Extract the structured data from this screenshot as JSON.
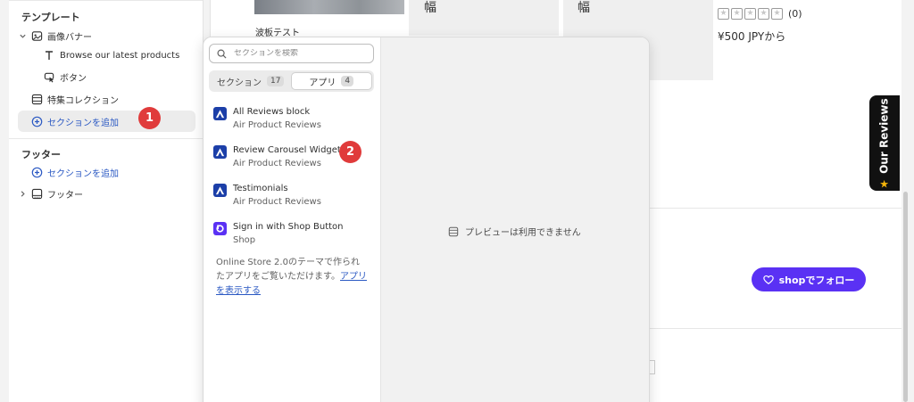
{
  "sidebar": {
    "template_heading": "テンプレート",
    "items": [
      {
        "label": "画像バナー"
      },
      {
        "label": "Browse our latest products"
      },
      {
        "label": "ボタン"
      },
      {
        "label": "特集コレクション"
      },
      {
        "label": "セクションを追加"
      }
    ],
    "footer_heading": "フッター",
    "footer_items": [
      {
        "label": "セクションを追加"
      },
      {
        "label": "フッター"
      }
    ]
  },
  "store": {
    "product_title": "波板テスト",
    "haba_1": "幅",
    "haba_2": "幅",
    "review_count": "(0)",
    "price": "¥500 JPYから",
    "follow_label": "でフォロー",
    "follow_brand": "shop",
    "reviews_tab": "Our Reviews"
  },
  "popover": {
    "search_placeholder": "セクションを検索",
    "tabs": [
      {
        "label": "セクション",
        "count": "17"
      },
      {
        "label": "アプリ",
        "count": "4",
        "active": true
      }
    ],
    "apps": [
      {
        "name": "All Reviews block",
        "vendor": "Air Product Reviews"
      },
      {
        "name": "Review Carousel Widget",
        "vendor": "Air Product Reviews"
      },
      {
        "name": "Testimonials",
        "vendor": "Air Product Reviews"
      },
      {
        "name": "Sign in with Shop Button",
        "vendor": "Shop"
      }
    ],
    "note_text": "Online Store 2.0のテーマで作られたアプリをご覧いただけます。",
    "note_link": "アプリを表示する",
    "preview_unavailable": "プレビューは利用できません"
  },
  "markers": [
    "1",
    "2"
  ],
  "colors": {
    "accent_blue": "#2b59c3",
    "shop_purple": "#5a31f4",
    "marker_red": "#e03b3b",
    "air_blue": "#1c3fa8"
  }
}
